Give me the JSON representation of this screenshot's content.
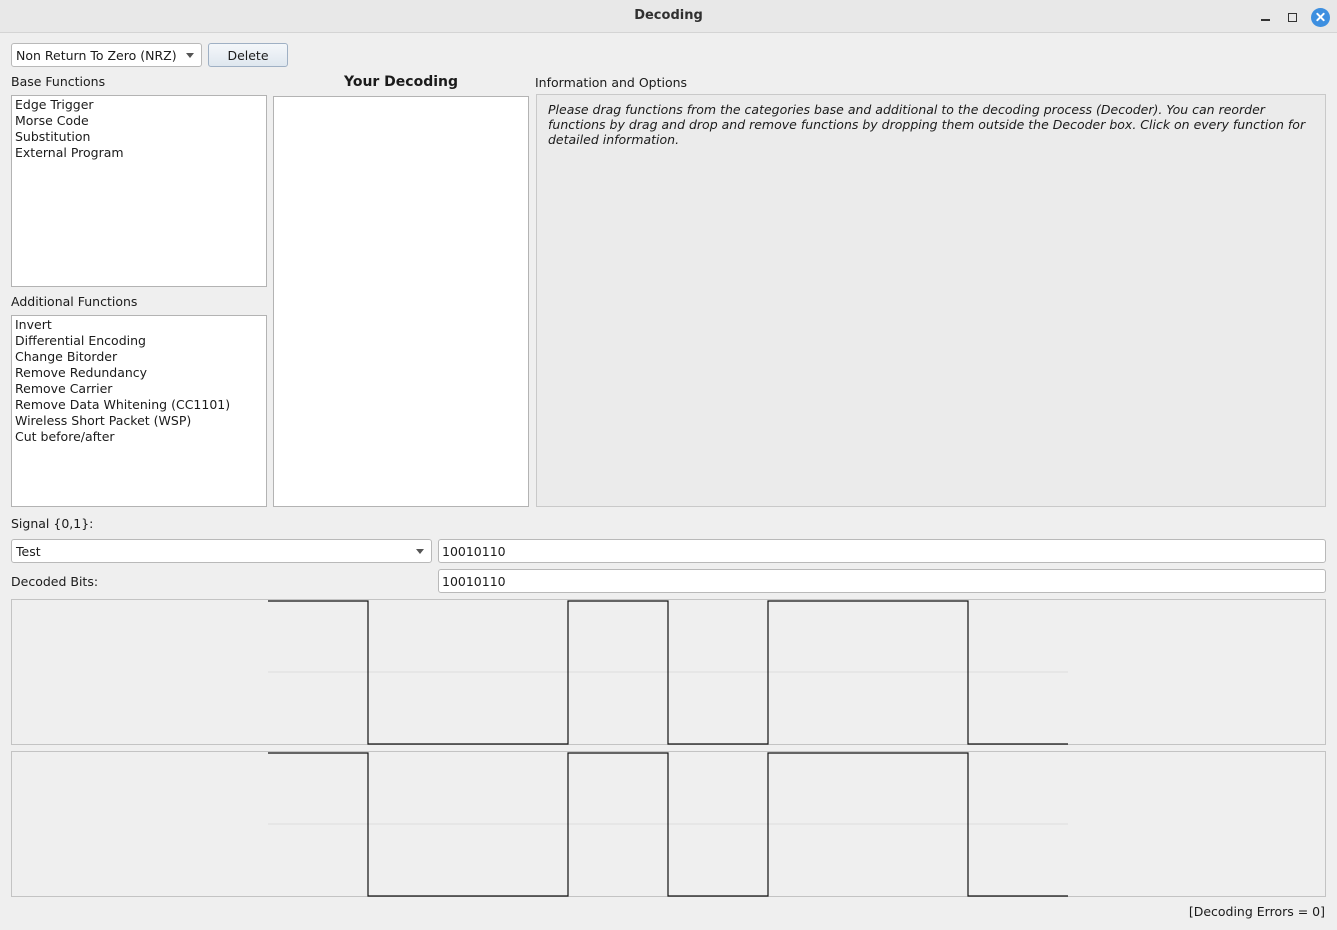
{
  "window": {
    "title": "Decoding",
    "controls": [
      "minimize-icon",
      "maximize-icon",
      "close-icon"
    ],
    "close_color": "#3d8fe0"
  },
  "toolbar": {
    "decoder_select": "Non Return To Zero (NRZ)",
    "delete_label": "Delete"
  },
  "base_functions": {
    "label": "Base Functions",
    "items": [
      "Edge Trigger",
      "Morse Code",
      "Substitution",
      "External Program"
    ]
  },
  "additional_functions": {
    "label": "Additional Functions",
    "items": [
      "Invert",
      "Differential Encoding",
      "Change Bitorder",
      "Remove Redundancy",
      "Remove Carrier",
      "Remove Data Whitening (CC1101)",
      "Wireless Short Packet (WSP)",
      "Cut before/after"
    ]
  },
  "decoder": {
    "heading": "Your Decoding",
    "items": []
  },
  "info": {
    "label": "Information and Options",
    "text": "Please drag functions from the categories base and additional to the decoding process (Decoder). You can reorder functions by drag and drop and remove functions by dropping them outside the Decoder box. Click on every function for detailed information."
  },
  "signal": {
    "label": "Signal {0,1}:",
    "select_value": "Test",
    "bits": "10010110"
  },
  "decoded": {
    "label": "Decoded Bits:",
    "bits": "10010110"
  },
  "plots": {
    "signal_bits": [
      1,
      0,
      0,
      1,
      0,
      1,
      1,
      0
    ],
    "decoded_bits": [
      1,
      0,
      0,
      1,
      0,
      1,
      1,
      0
    ]
  },
  "status": {
    "text": "[Decoding Errors = 0]"
  }
}
